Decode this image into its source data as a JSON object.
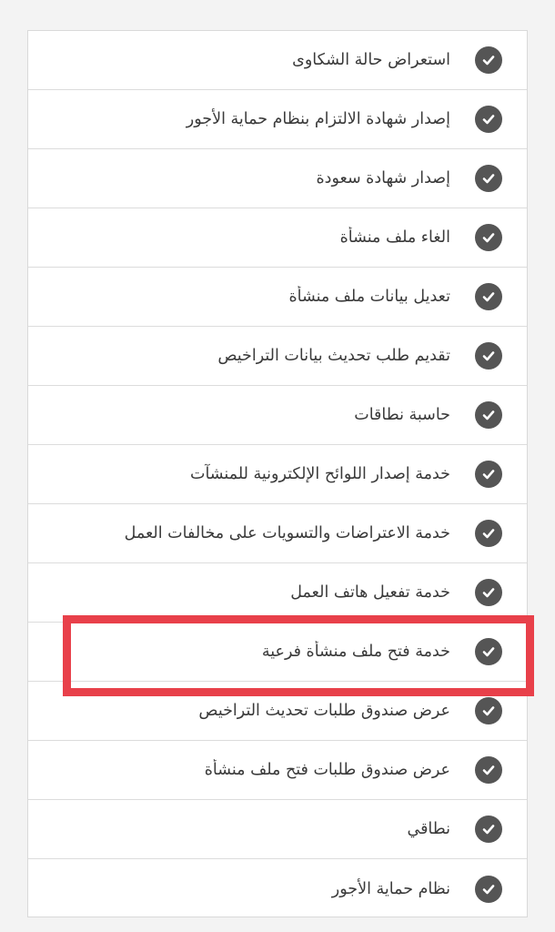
{
  "services": {
    "items": [
      {
        "label": "استعراض حالة الشكاوى",
        "icon": "check-circle-icon"
      },
      {
        "label": "إصدار شهادة الالتزام بنظام حماية الأجور",
        "icon": "check-circle-icon"
      },
      {
        "label": "إصدار شهادة سعودة",
        "icon": "check-circle-icon"
      },
      {
        "label": "الغاء ملف منشأة",
        "icon": "check-circle-icon"
      },
      {
        "label": "تعديل بيانات ملف منشأة",
        "icon": "check-circle-icon"
      },
      {
        "label": "تقديم طلب تحديث بيانات التراخيص",
        "icon": "check-circle-icon"
      },
      {
        "label": "حاسبة نطاقات",
        "icon": "check-circle-icon"
      },
      {
        "label": "خدمة إصدار اللوائح الإلكترونية للمنشآت",
        "icon": "check-circle-icon"
      },
      {
        "label": "خدمة الاعتراضات والتسويات على مخالفات العمل",
        "icon": "check-circle-icon"
      },
      {
        "label": "خدمة تفعيل هاتف العمل",
        "icon": "check-circle-icon"
      },
      {
        "label": "خدمة فتح ملف منشأة فرعية",
        "icon": "check-circle-icon"
      },
      {
        "label": "عرض صندوق طلبات تحديث التراخيص",
        "icon": "check-circle-icon"
      },
      {
        "label": "عرض صندوق طلبات فتح ملف منشأة",
        "icon": "check-circle-icon"
      },
      {
        "label": "نطاقي",
        "icon": "check-circle-icon"
      },
      {
        "label": "نظام حماية الأجور",
        "icon": "check-circle-icon"
      }
    ]
  },
  "highlight": {
    "target_item": "خدمة فتح ملف منشأة فرعية",
    "color": "#e8404a"
  },
  "colors": {
    "check_circle": "#555555",
    "text": "#3a3a3a",
    "divider": "#dcdcdc",
    "background": "#f3f3f3",
    "panel": "#ffffff"
  }
}
